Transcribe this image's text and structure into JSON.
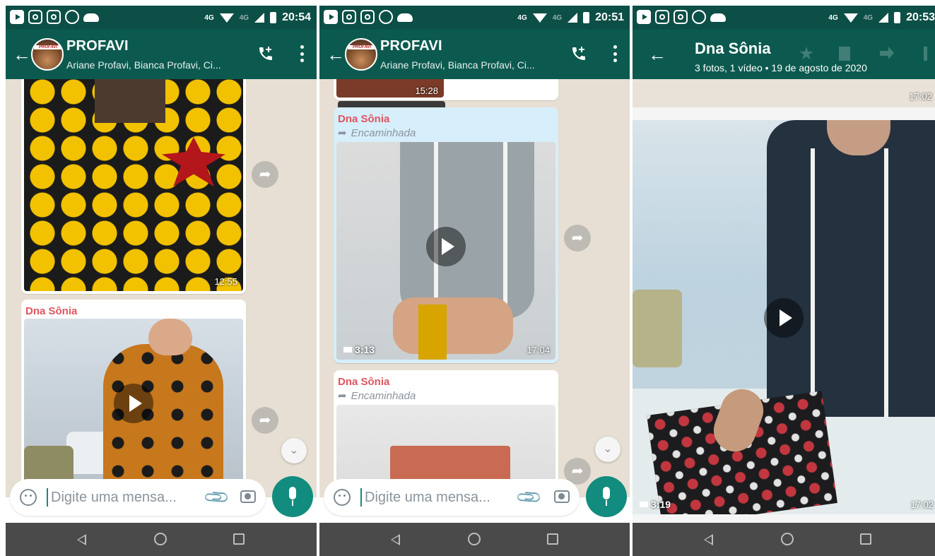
{
  "status_bar": {
    "p1_time": "20:54",
    "p2_time": "20:51",
    "p3_time": "20:53",
    "net_label": "4G",
    "volte_label": "4G"
  },
  "chat_header": {
    "title": "PROFAVI",
    "subtitle": "Ariane Profavi, Bianca Profavi, Ci...",
    "avatar_text": "PROFAVI"
  },
  "phone1": {
    "photo_time": "12:55",
    "video_sender": "Dna Sônia"
  },
  "phone2": {
    "prev_time": "15:28",
    "msg1": {
      "sender": "Dna Sônia",
      "forwarded": "Encaminhada",
      "duration": "3:13",
      "time": "17:04"
    },
    "msg2": {
      "sender": "Dna Sônia",
      "forwarded": "Encaminhada"
    }
  },
  "composer": {
    "placeholder": "Digite uma mensa..."
  },
  "viewer": {
    "title": "Dna Sônia",
    "subtitle": "3 fotos, 1 vídeo  •  19 de agosto de 2020",
    "top_time": "17:02",
    "duration": "3:19",
    "bottom_time": "17:02"
  },
  "colors": {
    "header": "#0c5a4f",
    "status": "#0c4f46",
    "accent": "#128c7e",
    "chat_bg": "#e7dfd3",
    "forward_bubble": "#d7eefb",
    "sender": "#e0555f"
  },
  "icons": {
    "back": "back-arrow-icon",
    "add_call": "add-call-icon",
    "menu": "more-vert-icon",
    "share": "forward-share-icon",
    "scroll": "double-chevron-down-icon",
    "emoji": "emoji-icon",
    "attach": "paperclip-icon",
    "camera": "camera-icon",
    "mic": "mic-icon"
  }
}
